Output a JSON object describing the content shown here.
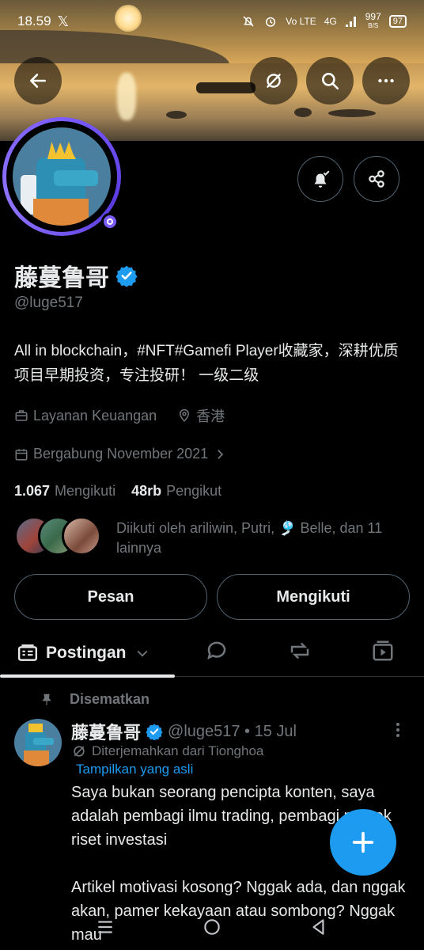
{
  "status_bar": {
    "time": "18.59",
    "network_type": "4G",
    "volte": "Vo LTE",
    "speed": "997",
    "speed_unit": "B/S",
    "battery": "97"
  },
  "header": {
    "back_icon": "arrow-left-icon",
    "grok_icon": "grok-icon",
    "search_icon": "search-icon",
    "more_icon": "more-horizontal-icon"
  },
  "profile": {
    "name": "藤蔓鲁哥",
    "handle": "@luge517",
    "bio": "All in blockchain，#NFT#Gamefi Player收藏家，深耕优质项目早期投资，专注投研！ 一级二级",
    "category": "Layanan Keuangan",
    "location": "香港",
    "joined": "Bergabung November 2021",
    "following_count": "1.067",
    "following_label": "Mengikuti",
    "followers_count": "48rb",
    "followers_label": "Pengikut",
    "followed_by": "Diikuti oleh ariliwin, Putri, 🎐 Belle, dan 11 lainnya",
    "message_button": "Pesan",
    "follow_button": "Mengikuti"
  },
  "tabs": {
    "active_label": "Postingan"
  },
  "post": {
    "pinned_label": "Disematkan",
    "author": "藤蔓鲁哥",
    "handle_date": "@luge517 • 15 Jul",
    "translated_from": "Diterjemahkan dari Tionghoa",
    "show_original": "Tampilkan yang asli",
    "text": "Saya bukan seorang pencipta konten, saya adalah pembagi ilmu trading, pembagi proyek riset investasi\n\nArtikel motivasi kosong? Nggak ada, dan nggak akan, pamer kekayaan atau sombong? Nggak mau"
  },
  "colors": {
    "accent": "#1d9bf0",
    "avatar_ring": "#7b5cff",
    "muted": "#71767b",
    "text": "#e7e9ea"
  }
}
